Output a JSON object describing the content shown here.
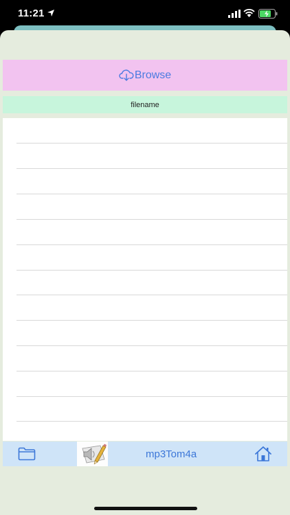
{
  "status_bar": {
    "time": "11:21"
  },
  "browse": {
    "label": "Browse",
    "icon": "cloud-download-icon"
  },
  "filename_header": {
    "label": "filename"
  },
  "file_list": {
    "rows": 12
  },
  "toolbar": {
    "folder_icon": "folder-icon",
    "app_icon": "speaker-pencil-icon",
    "title": "mp3Tom4a",
    "home_icon": "home-icon"
  },
  "colors": {
    "browse_bg": "#f2c3f0",
    "filename_bg": "#c7f5dc",
    "toolbar_bg": "#cfe4f8",
    "accent": "#3c77d8",
    "sheet_bg": "#e5ecde"
  }
}
